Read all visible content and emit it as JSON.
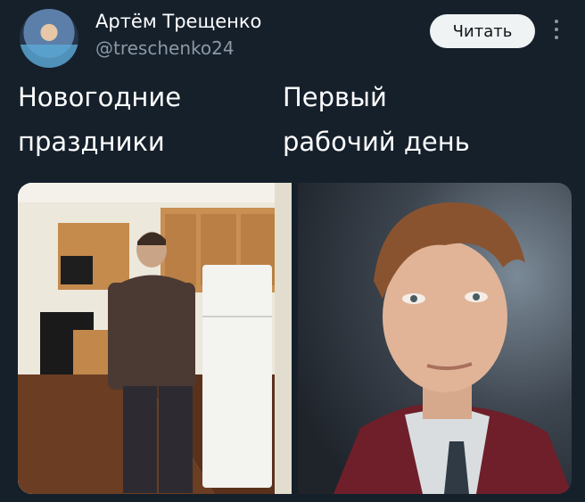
{
  "tweet": {
    "author_name": "Артём Трещенко",
    "author_handle": "@treschenko24",
    "read_button_label": "Читать",
    "caption_left": "Новогодние\nпраздники",
    "caption_right": "Первый\nрабочий день"
  },
  "icons": {
    "more": "more-vertical-icon"
  },
  "colors": {
    "background": "#15202b",
    "button_bg": "#eff3f4",
    "secondary_text": "#8b98a5"
  }
}
